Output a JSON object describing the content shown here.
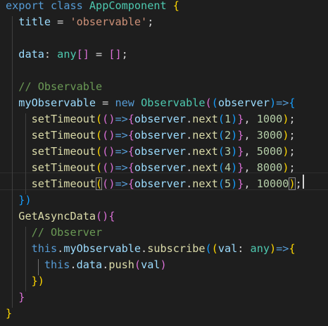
{
  "editor": {
    "language": "typescript",
    "cursor_line": 11,
    "lines": [
      {
        "tokens": [
          {
            "t": "export",
            "c": "kw"
          },
          {
            "t": " "
          },
          {
            "t": "class",
            "c": "kw"
          },
          {
            "t": " "
          },
          {
            "t": "AppComponent",
            "c": "cls"
          },
          {
            "t": " "
          },
          {
            "t": "{",
            "c": "b1"
          }
        ]
      },
      {
        "tokens": [
          {
            "t": "  "
          },
          {
            "t": "title",
            "c": "prop"
          },
          {
            "t": " = "
          },
          {
            "t": "'observable'",
            "c": "str"
          },
          {
            "t": ";"
          }
        ]
      },
      {
        "tokens": []
      },
      {
        "tokens": [
          {
            "t": "  "
          },
          {
            "t": "data",
            "c": "prop"
          },
          {
            "t": ": "
          },
          {
            "t": "any",
            "c": "cls"
          },
          {
            "t": "[]",
            "c": "b2"
          },
          {
            "t": " = "
          },
          {
            "t": "[]",
            "c": "b2"
          },
          {
            "t": ";"
          }
        ]
      },
      {
        "tokens": []
      },
      {
        "tokens": [
          {
            "t": "  "
          },
          {
            "t": "// Observable",
            "c": "cmt"
          }
        ]
      },
      {
        "tokens": [
          {
            "t": "  "
          },
          {
            "t": "myObservable",
            "c": "prop"
          },
          {
            "t": " = "
          },
          {
            "t": "new",
            "c": "kw"
          },
          {
            "t": " "
          },
          {
            "t": "Observable",
            "c": "cls"
          },
          {
            "t": "(",
            "c": "b2"
          },
          {
            "t": "(",
            "c": "b3"
          },
          {
            "t": "observer",
            "c": "prop"
          },
          {
            "t": ")",
            "c": "b3"
          },
          {
            "t": "=>",
            "c": "kw"
          },
          {
            "t": "{",
            "c": "b3"
          }
        ]
      },
      {
        "tokens": [
          {
            "t": "    "
          },
          {
            "t": "setTimeout",
            "c": "fn"
          },
          {
            "t": "(",
            "c": "b1"
          },
          {
            "t": "()",
            "c": "b2"
          },
          {
            "t": "=>",
            "c": "kw"
          },
          {
            "t": "{",
            "c": "b2"
          },
          {
            "t": "observer",
            "c": "prop"
          },
          {
            "t": "."
          },
          {
            "t": "next",
            "c": "fn"
          },
          {
            "t": "(",
            "c": "b3"
          },
          {
            "t": "1",
            "c": "num"
          },
          {
            "t": ")",
            "c": "b3"
          },
          {
            "t": "}",
            "c": "b2"
          },
          {
            "t": ", "
          },
          {
            "t": "1000",
            "c": "num"
          },
          {
            "t": ")",
            "c": "b1"
          },
          {
            "t": ";"
          }
        ]
      },
      {
        "tokens": [
          {
            "t": "    "
          },
          {
            "t": "setTimeout",
            "c": "fn"
          },
          {
            "t": "(",
            "c": "b1"
          },
          {
            "t": "()",
            "c": "b2"
          },
          {
            "t": "=>",
            "c": "kw"
          },
          {
            "t": "{",
            "c": "b2"
          },
          {
            "t": "observer",
            "c": "prop"
          },
          {
            "t": "."
          },
          {
            "t": "next",
            "c": "fn"
          },
          {
            "t": "(",
            "c": "b3"
          },
          {
            "t": "2",
            "c": "num"
          },
          {
            "t": ")",
            "c": "b3"
          },
          {
            "t": "}",
            "c": "b2"
          },
          {
            "t": ", "
          },
          {
            "t": "3000",
            "c": "num"
          },
          {
            "t": ")",
            "c": "b1"
          },
          {
            "t": ";"
          }
        ]
      },
      {
        "tokens": [
          {
            "t": "    "
          },
          {
            "t": "setTimeout",
            "c": "fn"
          },
          {
            "t": "(",
            "c": "b1"
          },
          {
            "t": "()",
            "c": "b2"
          },
          {
            "t": "=>",
            "c": "kw"
          },
          {
            "t": "{",
            "c": "b2"
          },
          {
            "t": "observer",
            "c": "prop"
          },
          {
            "t": "."
          },
          {
            "t": "next",
            "c": "fn"
          },
          {
            "t": "(",
            "c": "b3"
          },
          {
            "t": "3",
            "c": "num"
          },
          {
            "t": ")",
            "c": "b3"
          },
          {
            "t": "}",
            "c": "b2"
          },
          {
            "t": ", "
          },
          {
            "t": "5000",
            "c": "num"
          },
          {
            "t": ")",
            "c": "b1"
          },
          {
            "t": ";"
          }
        ]
      },
      {
        "tokens": [
          {
            "t": "    "
          },
          {
            "t": "setTimeout",
            "c": "fn"
          },
          {
            "t": "(",
            "c": "b1"
          },
          {
            "t": "()",
            "c": "b2"
          },
          {
            "t": "=>",
            "c": "kw"
          },
          {
            "t": "{",
            "c": "b2"
          },
          {
            "t": "observer",
            "c": "prop"
          },
          {
            "t": "."
          },
          {
            "t": "next",
            "c": "fn"
          },
          {
            "t": "(",
            "c": "b3"
          },
          {
            "t": "4",
            "c": "num"
          },
          {
            "t": ")",
            "c": "b3"
          },
          {
            "t": "}",
            "c": "b2"
          },
          {
            "t": ", "
          },
          {
            "t": "8000",
            "c": "num"
          },
          {
            "t": ")",
            "c": "b1"
          },
          {
            "t": ";"
          }
        ]
      },
      {
        "tokens": [
          {
            "t": "    "
          },
          {
            "t": "setTimeout",
            "c": "fn"
          },
          {
            "t": "(",
            "c": "b1 bm"
          },
          {
            "t": "()",
            "c": "b2"
          },
          {
            "t": "=>",
            "c": "kw"
          },
          {
            "t": "{",
            "c": "b2"
          },
          {
            "t": "observer",
            "c": "prop"
          },
          {
            "t": "."
          },
          {
            "t": "next",
            "c": "fn"
          },
          {
            "t": "(",
            "c": "b3"
          },
          {
            "t": "5",
            "c": "num"
          },
          {
            "t": ")",
            "c": "b3"
          },
          {
            "t": "}",
            "c": "b2"
          },
          {
            "t": ", "
          },
          {
            "t": "10000",
            "c": "num"
          },
          {
            "t": ")",
            "c": "b1 bm"
          },
          {
            "t": ";"
          }
        ]
      },
      {
        "tokens": [
          {
            "t": "  "
          },
          {
            "t": "})",
            "c": "b3"
          }
        ]
      },
      {
        "tokens": [
          {
            "t": "  "
          },
          {
            "t": "GetAsyncData",
            "c": "fn"
          },
          {
            "t": "()",
            "c": "b2"
          },
          {
            "t": "{",
            "c": "b2"
          }
        ]
      },
      {
        "tokens": [
          {
            "t": "    "
          },
          {
            "t": "// Observer",
            "c": "cmt"
          }
        ]
      },
      {
        "tokens": [
          {
            "t": "    "
          },
          {
            "t": "this",
            "c": "kw"
          },
          {
            "t": "."
          },
          {
            "t": "myObservable",
            "c": "prop"
          },
          {
            "t": "."
          },
          {
            "t": "subscribe",
            "c": "fn"
          },
          {
            "t": "(",
            "c": "b3"
          },
          {
            "t": "(",
            "c": "b1"
          },
          {
            "t": "val",
            "c": "prop"
          },
          {
            "t": ": "
          },
          {
            "t": "any",
            "c": "cls"
          },
          {
            "t": ")",
            "c": "b1"
          },
          {
            "t": "=>",
            "c": "kw"
          },
          {
            "t": "{",
            "c": "b1"
          }
        ]
      },
      {
        "tokens": [
          {
            "t": "      "
          },
          {
            "t": "this",
            "c": "kw"
          },
          {
            "t": "."
          },
          {
            "t": "data",
            "c": "prop"
          },
          {
            "t": "."
          },
          {
            "t": "push",
            "c": "fn"
          },
          {
            "t": "(",
            "c": "b2"
          },
          {
            "t": "val",
            "c": "prop"
          },
          {
            "t": ")",
            "c": "b2"
          }
        ]
      },
      {
        "tokens": [
          {
            "t": "    "
          },
          {
            "t": "})",
            "c": "b1"
          }
        ]
      },
      {
        "tokens": [
          {
            "t": "  "
          },
          {
            "t": "}",
            "c": "b2"
          }
        ]
      },
      {
        "tokens": [
          {
            "t": "}",
            "c": "b1"
          }
        ]
      }
    ]
  }
}
